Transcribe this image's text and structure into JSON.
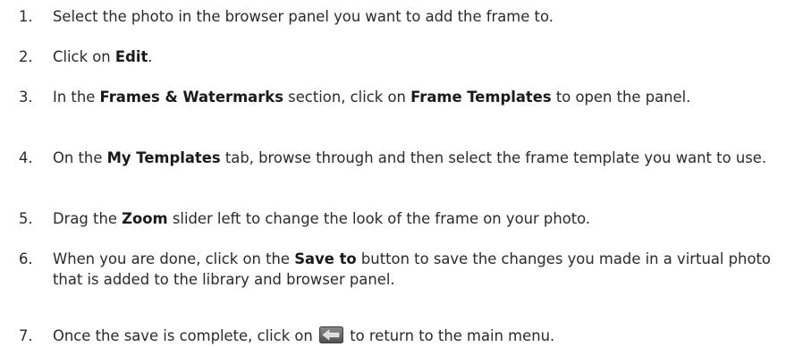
{
  "steps": [
    {
      "number": "1.",
      "segments": [
        {
          "text": "Select the photo in the browser panel you want to add the frame to.",
          "bold": false
        }
      ]
    },
    {
      "number": "2.",
      "segments": [
        {
          "text": "Click on ",
          "bold": false
        },
        {
          "text": "Edit",
          "bold": true
        },
        {
          "text": ".",
          "bold": false
        }
      ]
    },
    {
      "number": "3.",
      "segments": [
        {
          "text": "In the ",
          "bold": false
        },
        {
          "text": "Frames & Watermarks",
          "bold": true
        },
        {
          "text": " section, click on ",
          "bold": false
        },
        {
          "text": "Frame Templates",
          "bold": true
        },
        {
          "text": " to open the panel.",
          "bold": false
        }
      ]
    },
    {
      "number": "4.",
      "segments": [
        {
          "text": "On the ",
          "bold": false
        },
        {
          "text": "My Templates",
          "bold": true
        },
        {
          "text": " tab, browse through and then select the frame template you want to use.",
          "bold": false
        }
      ]
    },
    {
      "number": "5.",
      "segments": [
        {
          "text": "Drag the ",
          "bold": false
        },
        {
          "text": "Zoom",
          "bold": true
        },
        {
          "text": " slider left to change the look of the frame on your photo.",
          "bold": false
        }
      ]
    },
    {
      "number": "6.",
      "segments": [
        {
          "text": "When you are done, click on the ",
          "bold": false
        },
        {
          "text": "Save to",
          "bold": true
        },
        {
          "text": " button to save the changes you made in a virtual photo that is added to the library and browser panel.",
          "bold": false
        }
      ]
    },
    {
      "number": "7.",
      "segments": [
        {
          "text": "Once the save is complete, click on ",
          "bold": false
        },
        {
          "icon": "back-arrow-icon"
        },
        {
          "text": " to return to the main menu.",
          "bold": false
        }
      ]
    }
  ],
  "icons": {
    "back-arrow-icon": {
      "body": "#6e6e6e",
      "arrow": "#d9d9d9"
    }
  }
}
